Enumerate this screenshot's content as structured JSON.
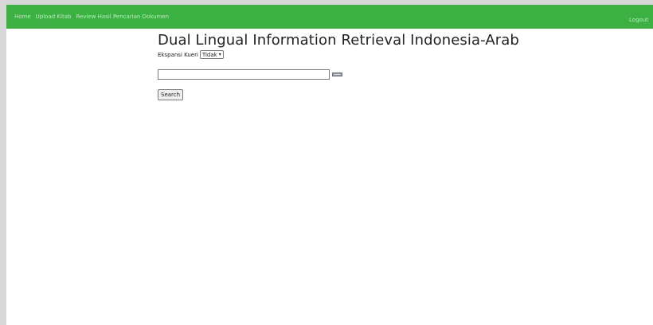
{
  "navbar": {
    "links": [
      "Home",
      "Upload Kitab",
      "Review Hasil Pencarian Dokumen"
    ],
    "logout": "Logout",
    "background_color": "#3cb043",
    "link_color": "#b9ecbc"
  },
  "main": {
    "title": "Dual Lingual Information Retrieval Indonesia-Arab",
    "expansion_label": "Ekspansi Kueri",
    "expansion_select": {
      "selected": "Tidak"
    },
    "search_input": {
      "value": "",
      "placeholder": ""
    },
    "keyboard_icon": "keyboard-icon",
    "search_button": "Search"
  }
}
